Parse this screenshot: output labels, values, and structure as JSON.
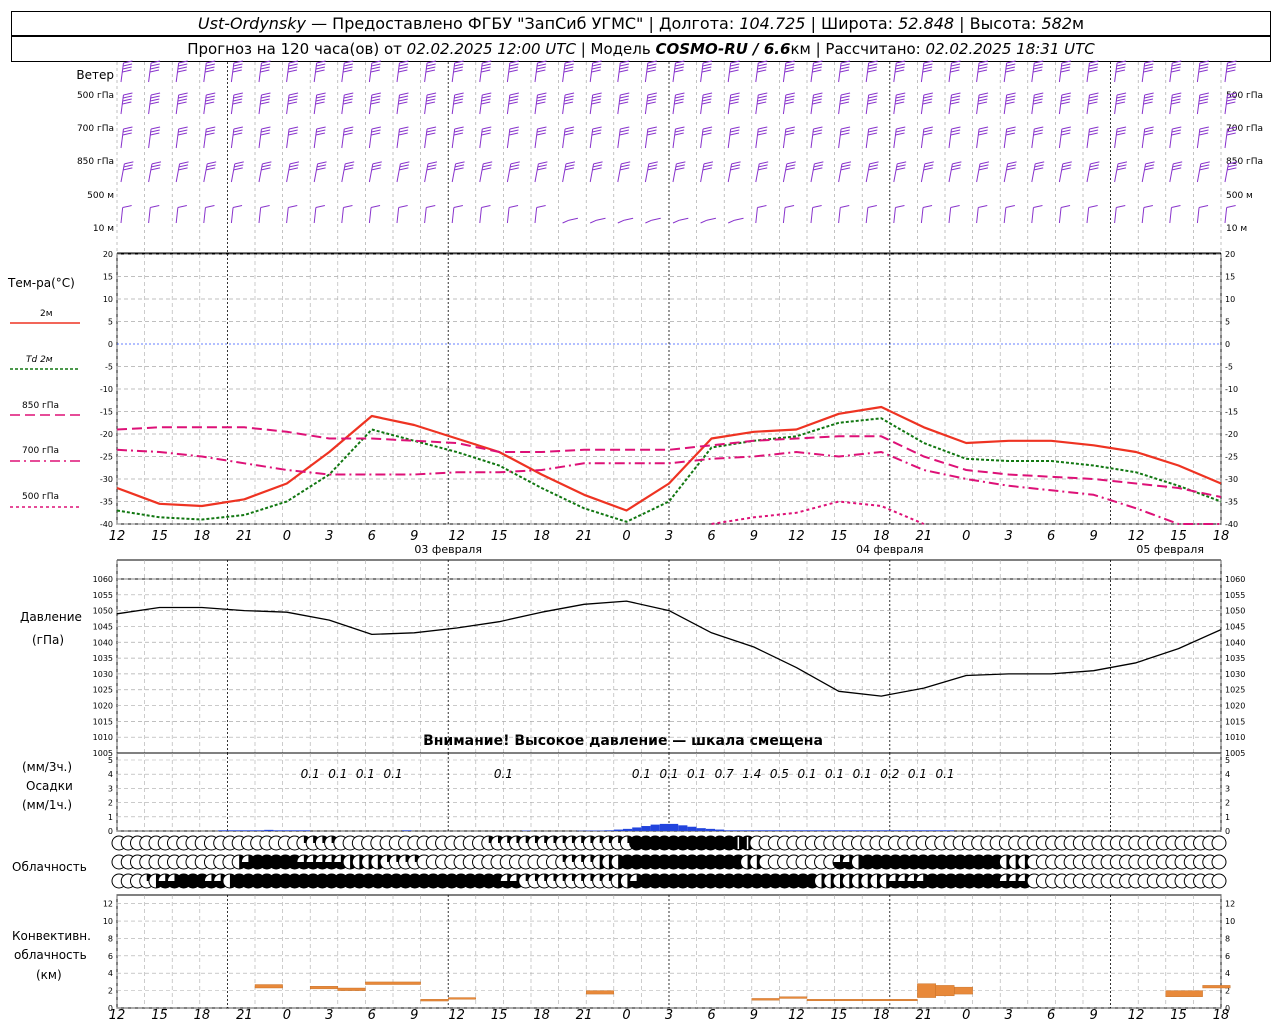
{
  "header": {
    "station": "Ust-Ordynsky",
    "provider": "— Предоставлено ФГБУ \"ЗапСиб УГМС\"",
    "lon_label": "Долгота:",
    "lon_value": "104.725",
    "lat_label": "Широта:",
    "lat_value": "52.848",
    "alt_label": "Высота:",
    "alt_value": "582",
    "alt_unit": "м",
    "forecast_label": "Прогноз на 120 часа(ов) от",
    "forecast_start": "02.02.2025 12:00 UTC",
    "model_label": "Модель",
    "model_name": "COSMO-RU / 6.6",
    "model_unit": "км",
    "calc_label": "Рассчитано:",
    "calc_time": "02.02.2025 18:31 UTC"
  },
  "panels": {
    "wind": {
      "title": "Ветер",
      "levels": [
        "500 гПа",
        "700 гПа",
        "850 гПа",
        "500 м",
        "10 м"
      ]
    },
    "temp": {
      "title": "Тем-ра(°C)",
      "legend": [
        {
          "label": "2м",
          "color": "#ee3322",
          "style": "solid"
        },
        {
          "label": "Td  2м",
          "color": "#117711",
          "style": "dotted"
        },
        {
          "label": "850 гПа",
          "color": "#dd1177",
          "style": "dashed"
        },
        {
          "label": "700 гПа",
          "color": "#dd1177",
          "style": "dashdot"
        },
        {
          "label": "500 гПа",
          "color": "#dd1177",
          "style": "dotted"
        }
      ]
    },
    "pressure": {
      "title": "Давление",
      "unit": "(гПа)",
      "warning": "Внимание! Высокое давление — шкала смещена"
    },
    "precip": {
      "unit3h": "(мм/3ч.)",
      "title": "Осадки",
      "unit1h": "(мм/1ч.)"
    },
    "clouds": {
      "title": "Облачность"
    },
    "convective": {
      "title": "Конвективн.",
      "title2": "облачность",
      "unit": "(км)"
    }
  },
  "date_labels": [
    "03 февраля",
    "04 февраля",
    "05 февраля"
  ],
  "chart_data": [
    {
      "type": "line",
      "title": "Тем-ра(°C)",
      "x_hours": [
        12,
        15,
        18,
        21,
        0,
        3,
        6,
        9,
        12,
        15,
        18,
        21,
        0,
        3,
        6,
        9,
        12,
        15,
        18,
        21,
        0,
        3,
        6,
        9,
        12,
        15,
        18
      ],
      "ylim": [
        -40,
        20
      ],
      "y_ticks": [
        20,
        15,
        10,
        5,
        0,
        -5,
        -10,
        -15,
        -20,
        -25,
        -30,
        -35,
        -40
      ],
      "series": [
        {
          "name": "2м",
          "color": "#ee3322",
          "dash": "",
          "values": [
            -32,
            -35.5,
            -36,
            -34.5,
            -31,
            -24,
            -16,
            -18,
            -21,
            -24,
            -29,
            -33.5,
            -37,
            -31,
            -21,
            -19.5,
            -19,
            -15.5,
            -14,
            -18.5,
            -22,
            -21.5,
            -21.5,
            -22.5,
            -24,
            -27,
            -31
          ]
        },
        {
          "name": "Td  2м",
          "color": "#117711",
          "dash": "3,2",
          "values": [
            -37,
            -38.5,
            -39,
            -38,
            -35,
            -29,
            -19,
            -21.5,
            -24,
            -27,
            -32,
            -36.5,
            -39.5,
            -35,
            -23,
            -21.5,
            -20.5,
            -17.5,
            -16.5,
            -22,
            -25.5,
            -26,
            -26,
            -27,
            -28.5,
            -31.5,
            -35
          ]
        },
        {
          "name": "850 гПа",
          "color": "#dd1177",
          "dash": "10,5",
          "values": [
            -19,
            -18.5,
            -18.5,
            -18.5,
            -19.5,
            -21,
            -21,
            -21.5,
            -22,
            -24,
            -24,
            -23.5,
            -23.5,
            -23.5,
            -22.5,
            -21.5,
            -21,
            -20.5,
            -20.5,
            -25,
            -28,
            -29,
            -29.5,
            -30,
            -31,
            -32,
            -34
          ]
        },
        {
          "name": "700 гПа",
          "color": "#dd1177",
          "dash": "10,4,2,4",
          "values": [
            -23.5,
            -24,
            -25,
            -26.5,
            -28,
            -29,
            -29,
            -29,
            -28.5,
            -28.5,
            -28,
            -26.5,
            -26.5,
            -26.5,
            -25.5,
            -25,
            -24,
            -25,
            -24,
            -28,
            -30,
            -31.5,
            -32.5,
            -33.5,
            -36.5,
            -40.5,
            -42
          ]
        },
        {
          "name": "500 гПа",
          "color": "#dd1177",
          "dash": "3,3",
          "values": [
            null,
            null,
            null,
            null,
            null,
            null,
            null,
            null,
            null,
            null,
            null,
            null,
            null,
            null,
            -40,
            -38.5,
            -37.5,
            -35,
            -36,
            -40,
            null,
            null,
            null,
            null,
            null,
            null,
            null
          ]
        }
      ]
    },
    {
      "type": "line",
      "title": "Давление",
      "x_hours": [
        12,
        15,
        18,
        21,
        0,
        3,
        6,
        9,
        12,
        15,
        18,
        21,
        0,
        3,
        6,
        9,
        12,
        15,
        18,
        21,
        0,
        3,
        6,
        9,
        12,
        15,
        18
      ],
      "ylim": [
        1005,
        1060
      ],
      "y_ticks": [
        1060,
        1055,
        1050,
        1045,
        1040,
        1035,
        1030,
        1025,
        1020,
        1015,
        1010,
        1005
      ],
      "series": [
        {
          "name": "Давление",
          "color": "#000000",
          "values": [
            1049,
            1051,
            1051,
            1050,
            1049.5,
            1047,
            1042.5,
            1043,
            1044.5,
            1046.5,
            1049.5,
            1052,
            1053,
            1050,
            1043,
            1038.5,
            1032,
            1024.5,
            1023,
            1025.5,
            1029.5,
            1030,
            1030,
            1031,
            1033.5,
            1038,
            1044
          ]
        }
      ]
    },
    {
      "type": "bar",
      "title": "Осадки",
      "ylim": [
        0,
        5
      ],
      "y_ticks": [
        5,
        4,
        3,
        2,
        1,
        0
      ],
      "labels_3h": [
        {
          "h": 21,
          "v": "0.1"
        },
        {
          "h": 24,
          "v": "0.1"
        },
        {
          "h": 27,
          "v": "0.1"
        },
        {
          "h": 30,
          "v": "0.1"
        },
        {
          "h": 42,
          "v": "0.1"
        },
        {
          "h": 57,
          "v": "0.1"
        },
        {
          "h": 60,
          "v": "0.1"
        },
        {
          "h": 63,
          "v": "0.1"
        },
        {
          "h": 66,
          "v": "0.7"
        },
        {
          "h": 69,
          "v": "1.4"
        },
        {
          "h": 72,
          "v": "0.5"
        },
        {
          "h": 75,
          "v": "0.1"
        },
        {
          "h": 78,
          "v": "0.1"
        },
        {
          "h": 81,
          "v": "0.1"
        },
        {
          "h": 84,
          "v": "0.2"
        },
        {
          "h": 87,
          "v": "0.1"
        },
        {
          "h": 90,
          "v": "0.1"
        }
      ],
      "hourly": [
        {
          "h": 11,
          "v": 0.05
        },
        {
          "h": 12,
          "v": 0.05
        },
        {
          "h": 13,
          "v": 0.05
        },
        {
          "h": 14,
          "v": 0.05
        },
        {
          "h": 15,
          "v": 0.05
        },
        {
          "h": 16,
          "v": 0.08
        },
        {
          "h": 17,
          "v": 0.05
        },
        {
          "h": 18,
          "v": 0.05
        },
        {
          "h": 19,
          "v": 0.05
        },
        {
          "h": 20,
          "v": 0.05
        },
        {
          "h": 31,
          "v": 0.05
        },
        {
          "h": 44,
          "v": 0.03
        },
        {
          "h": 50,
          "v": 0.02
        },
        {
          "h": 51,
          "v": 0.03
        },
        {
          "h": 52,
          "v": 0.03
        },
        {
          "h": 53,
          "v": 0.05
        },
        {
          "h": 54,
          "v": 0.1
        },
        {
          "h": 55,
          "v": 0.15
        },
        {
          "h": 56,
          "v": 0.25
        },
        {
          "h": 57,
          "v": 0.35
        },
        {
          "h": 58,
          "v": 0.45
        },
        {
          "h": 59,
          "v": 0.5
        },
        {
          "h": 60,
          "v": 0.5
        },
        {
          "h": 61,
          "v": 0.4
        },
        {
          "h": 62,
          "v": 0.3
        },
        {
          "h": 63,
          "v": 0.2
        },
        {
          "h": 64,
          "v": 0.15
        },
        {
          "h": 65,
          "v": 0.1
        },
        {
          "h": 66,
          "v": 0.05
        },
        {
          "h": 67,
          "v": 0.05
        },
        {
          "h": 68,
          "v": 0.05
        },
        {
          "h": 69,
          "v": 0.05
        },
        {
          "h": 70,
          "v": 0.05
        },
        {
          "h": 71,
          "v": 0.05
        },
        {
          "h": 72,
          "v": 0.05
        },
        {
          "h": 73,
          "v": 0.05
        },
        {
          "h": 74,
          "v": 0.05
        },
        {
          "h": 75,
          "v": 0.05
        },
        {
          "h": 76,
          "v": 0.05
        },
        {
          "h": 77,
          "v": 0.05
        },
        {
          "h": 78,
          "v": 0.05
        },
        {
          "h": 79,
          "v": 0.05
        },
        {
          "h": 80,
          "v": 0.05
        },
        {
          "h": 81,
          "v": 0.05
        },
        {
          "h": 82,
          "v": 0.05
        },
        {
          "h": 83,
          "v": 0.05
        },
        {
          "h": 84,
          "v": 0.05
        },
        {
          "h": 85,
          "v": 0.05
        },
        {
          "h": 86,
          "v": 0.05
        },
        {
          "h": 87,
          "v": 0.05
        },
        {
          "h": 88,
          "v": 0.05
        },
        {
          "h": 89,
          "v": 0.05
        },
        {
          "h": 90,
          "v": 0.05
        }
      ]
    },
    {
      "type": "table",
      "title": "Облачность",
      "note": "cloud octa symbols per hour; 0=clear, 8=overcast",
      "rows": [
        {
          "segments": [
            [
              0,
              20,
              0
            ],
            [
              20,
              24,
              2
            ],
            [
              24,
              40,
              0
            ],
            [
              40,
              56,
              2
            ],
            [
              56,
              67,
              8
            ],
            [
              67,
              69,
              7
            ],
            [
              69,
              120,
              0
            ]
          ]
        },
        {
          "segments": [
            [
              0,
              13,
              0
            ],
            [
              13,
              14,
              4
            ],
            [
              14,
              15,
              6
            ],
            [
              15,
              20,
              8
            ],
            [
              20,
              25,
              6
            ],
            [
              25,
              29,
              4
            ],
            [
              29,
              33,
              2
            ],
            [
              33,
              48,
              0
            ],
            [
              48,
              52,
              2
            ],
            [
              52,
              55,
              4
            ],
            [
              55,
              68,
              8
            ],
            [
              68,
              70,
              4
            ],
            [
              70,
              78,
              0
            ],
            [
              78,
              80,
              6
            ],
            [
              80,
              81,
              4
            ],
            [
              81,
              96,
              8
            ],
            [
              96,
              99,
              4
            ],
            [
              99,
              120,
              0
            ]
          ]
        },
        {
          "segments": [
            [
              0,
              3,
              0
            ],
            [
              3,
              4,
              2
            ],
            [
              4,
              5,
              4
            ],
            [
              5,
              7,
              6
            ],
            [
              7,
              10,
              8
            ],
            [
              10,
              12,
              6
            ],
            [
              12,
              13,
              4
            ],
            [
              13,
              15,
              8
            ],
            [
              15,
              20,
              8
            ],
            [
              20,
              22,
              8
            ],
            [
              22,
              42,
              8
            ],
            [
              42,
              44,
              6
            ],
            [
              44,
              46,
              2
            ],
            [
              46,
              54,
              2
            ],
            [
              54,
              56,
              4
            ],
            [
              56,
              57,
              6
            ],
            [
              57,
              65,
              8
            ],
            [
              65,
              70,
              8
            ],
            [
              70,
              76,
              8
            ],
            [
              76,
              84,
              4
            ],
            [
              84,
              88,
              6
            ],
            [
              88,
              96,
              8
            ],
            [
              96,
              99,
              6
            ],
            [
              99,
              120,
              0
            ]
          ]
        }
      ]
    },
    {
      "type": "bar",
      "title": "Конвективн. облачность",
      "ylim": [
        0,
        13
      ],
      "y_ticks": [
        12,
        10,
        8,
        6,
        4,
        2,
        0
      ],
      "segments": [
        {
          "h0": 15,
          "h1": 18,
          "lo": 2.3,
          "hi": 2.7
        },
        {
          "h0": 21,
          "h1": 24,
          "lo": 2.2,
          "hi": 2.5
        },
        {
          "h0": 24,
          "h1": 27,
          "lo": 2.0,
          "hi": 2.3
        },
        {
          "h0": 27,
          "h1": 33,
          "lo": 2.7,
          "hi": 3.0
        },
        {
          "h0": 33,
          "h1": 36,
          "lo": 0.8,
          "hi": 1.0
        },
        {
          "h0": 36,
          "h1": 39,
          "lo": 1.0,
          "hi": 1.2
        },
        {
          "h0": 51,
          "h1": 54,
          "lo": 1.6,
          "hi": 2.0
        },
        {
          "h0": 69,
          "h1": 72,
          "lo": 0.9,
          "hi": 1.1
        },
        {
          "h0": 72,
          "h1": 75,
          "lo": 1.1,
          "hi": 1.3
        },
        {
          "h0": 75,
          "h1": 78,
          "lo": 0.9,
          "hi": 1.0
        },
        {
          "h0": 78,
          "h1": 81,
          "lo": 0.9,
          "hi": 1.0
        },
        {
          "h0": 81,
          "h1": 87,
          "lo": 0.9,
          "hi": 1.0
        },
        {
          "h0": 87,
          "h1": 89,
          "lo": 1.2,
          "hi": 2.8
        },
        {
          "h0": 89,
          "h1": 91,
          "lo": 1.4,
          "hi": 2.6
        },
        {
          "h0": 91,
          "h1": 93,
          "lo": 1.6,
          "hi": 2.4
        },
        {
          "h0": 114,
          "h1": 118,
          "lo": 1.3,
          "hi": 2.0
        },
        {
          "h0": 118,
          "h1": 121,
          "lo": 2.3,
          "hi": 2.6
        }
      ]
    }
  ],
  "x_tick_labels": [
    "12",
    "15",
    "18",
    "21",
    "0",
    "3",
    "6",
    "9",
    "12",
    "15",
    "18",
    "21",
    "0",
    "3",
    "6",
    "9",
    "12",
    "15",
    "18",
    "21",
    "0",
    "3",
    "6",
    "9",
    "12",
    "15",
    "18"
  ]
}
